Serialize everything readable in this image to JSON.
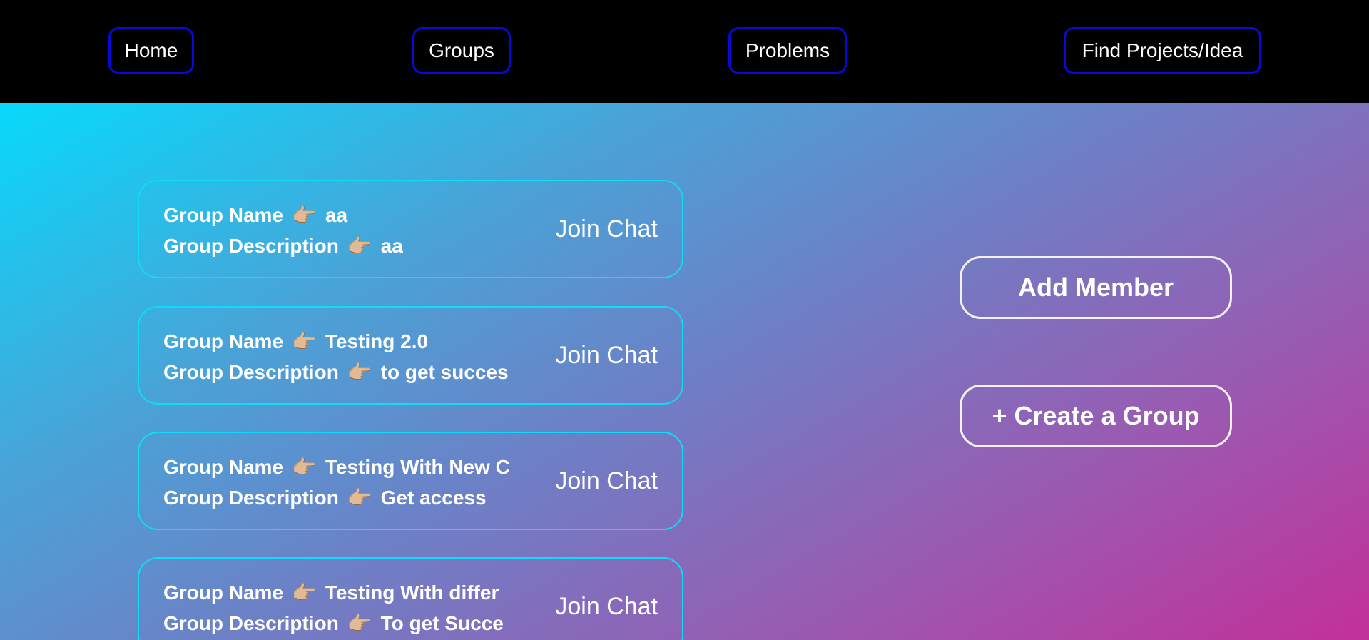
{
  "nav": {
    "items": [
      {
        "label": "Home"
      },
      {
        "label": "Groups"
      },
      {
        "label": "Problems"
      },
      {
        "label": "Find Projects/Idea"
      }
    ]
  },
  "groups": {
    "name_label": "Group Name",
    "description_label": "Group Description",
    "pointer_icon": "👉🏼",
    "join_label": "Join Chat",
    "items": [
      {
        "name": "aa",
        "description": "aa"
      },
      {
        "name": "Testing 2.0",
        "description": "to get succes"
      },
      {
        "name": "Testing With New C",
        "description": "Get access"
      },
      {
        "name": "Testing With differ",
        "description": "To get Succe"
      }
    ]
  },
  "actions": {
    "add_member": "Add Member",
    "create_group": "+ Create a Group"
  },
  "colors": {
    "nav_background": "#000000",
    "nav_border": "#0a0ad8",
    "card_border": "#10dcf8",
    "gradient_start": "#08d9fb",
    "gradient_end": "#c3309a"
  }
}
